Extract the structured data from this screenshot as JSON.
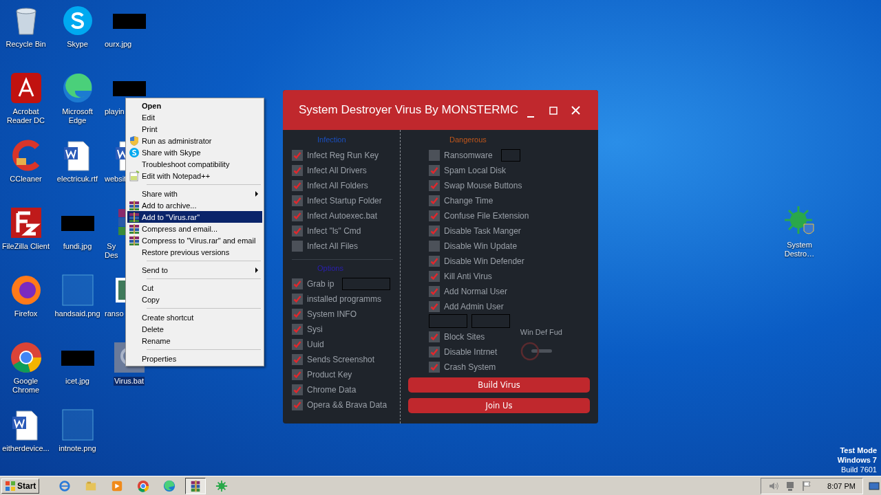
{
  "desktop_icons": [
    {
      "label": "Recycle Bin",
      "kind": "recycle",
      "selected": false
    },
    {
      "label": "Acrobat Reader DC",
      "kind": "acrobat",
      "selected": false
    },
    {
      "label": "CCleaner",
      "kind": "ccleaner",
      "selected": false
    },
    {
      "label": "FileZilla Client",
      "kind": "filezilla",
      "selected": false
    },
    {
      "label": "Firefox",
      "kind": "firefox",
      "selected": false
    },
    {
      "label": "Google Chrome",
      "kind": "chrome",
      "selected": false
    },
    {
      "label": "eitherdevice...",
      "kind": "word",
      "selected": false
    },
    {
      "label": "Skype",
      "kind": "skype",
      "selected": false
    },
    {
      "label": "Microsoft Edge",
      "kind": "edge",
      "selected": false
    },
    {
      "label": "electricuk.rtf",
      "kind": "word",
      "selected": false
    },
    {
      "label": "fundi.jpg",
      "kind": "redacted",
      "selected": false
    },
    {
      "label": "handsaid.png",
      "kind": "blank",
      "selected": false
    },
    {
      "label": "icet.jpg",
      "kind": "redacted",
      "selected": false
    },
    {
      "label": "intnote.png",
      "kind": "blank",
      "selected": false
    },
    {
      "label": "ourx.jpg",
      "kind": "redacted",
      "selected": false
    },
    {
      "label": "playin",
      "kind": "redacted",
      "selected": false
    },
    {
      "label": "websit",
      "kind": "word",
      "selected": false
    },
    {
      "label": "Sy\nDes",
      "kind": "winrar",
      "selected": false
    },
    {
      "label": "ranso",
      "kind": "image",
      "selected": false
    },
    {
      "label": "Virus.bat",
      "kind": "bat",
      "selected": true
    }
  ],
  "right_icon": {
    "label": "System Destro…",
    "kind": "virus"
  },
  "context_menu": [
    {
      "kind": "item",
      "label": "Open",
      "bold": true,
      "selected": false
    },
    {
      "kind": "item",
      "label": "Edit",
      "bold": false,
      "selected": false
    },
    {
      "kind": "item",
      "label": "Print",
      "bold": false,
      "selected": false
    },
    {
      "kind": "shield_item",
      "label": "Run as administrator",
      "bold": false,
      "selected": false
    },
    {
      "kind": "chat_item",
      "label": "Share with Skype",
      "bold": false,
      "selected": false
    },
    {
      "kind": "item",
      "label": "Troubleshoot compatibility",
      "bold": false,
      "selected": false
    },
    {
      "kind": "notepad_item",
      "label": "Edit with Notepad++",
      "bold": false,
      "selected": false
    },
    {
      "kind": "separator"
    },
    {
      "kind": "submenu",
      "label": "Share with",
      "bold": false,
      "selected": false
    },
    {
      "kind": "archive_item",
      "label": "Add to archive...",
      "bold": false,
      "selected": false
    },
    {
      "kind": "archive_item",
      "label": "Add to \"Virus.rar\"",
      "bold": false,
      "selected": true
    },
    {
      "kind": "archive_item",
      "label": "Compress and email...",
      "bold": false,
      "selected": false
    },
    {
      "kind": "archive_item",
      "label": "Compress to \"Virus.rar\" and email",
      "bold": false,
      "selected": false
    },
    {
      "kind": "item",
      "label": "Restore previous versions",
      "bold": false,
      "selected": false
    },
    {
      "kind": "separator"
    },
    {
      "kind": "submenu",
      "label": "Send to",
      "bold": false,
      "selected": false
    },
    {
      "kind": "separator"
    },
    {
      "kind": "item",
      "label": "Cut",
      "bold": false,
      "selected": false
    },
    {
      "kind": "item",
      "label": "Copy",
      "bold": false,
      "selected": false
    },
    {
      "kind": "separator"
    },
    {
      "kind": "item",
      "label": "Create shortcut",
      "bold": false,
      "selected": false
    },
    {
      "kind": "item",
      "label": "Delete",
      "bold": false,
      "selected": false
    },
    {
      "kind": "item",
      "label": "Rename",
      "bold": false,
      "selected": false
    },
    {
      "kind": "separator"
    },
    {
      "kind": "item",
      "label": "Properties",
      "bold": false,
      "selected": false
    }
  ],
  "window": {
    "title": "System Destroyer Virus By MONSTERMC",
    "left_sections": [
      {
        "heading": "Infection",
        "color": "#1a4fc0",
        "items": [
          {
            "kind": "checkbox",
            "label": "Infect Reg Run Key",
            "checked": true
          },
          {
            "kind": "checkbox",
            "label": "Infect All Drivers",
            "checked": true
          },
          {
            "kind": "checkbox",
            "label": "Infect All Folders",
            "checked": true
          },
          {
            "kind": "checkbox",
            "label": "Infect Startup Folder",
            "checked": true
          },
          {
            "kind": "checkbox",
            "label": "Infect Autoexec.bat",
            "checked": true
          },
          {
            "kind": "checkbox",
            "label": "Infect \"ls\" Cmd",
            "checked": true
          },
          {
            "kind": "checkbox",
            "label": "Infect All  Files",
            "checked": false
          }
        ]
      },
      {
        "heading": "Options",
        "color": "#2a1fb0",
        "items": [
          {
            "kind": "checkbox_field",
            "label": "Grab ip",
            "checked": true
          },
          {
            "kind": "checkbox",
            "label": "installed programms",
            "checked": true
          },
          {
            "kind": "checkbox",
            "label": "System INFO",
            "checked": true
          },
          {
            "kind": "checkbox",
            "label": "Sysi",
            "checked": true
          },
          {
            "kind": "checkbox",
            "label": "Uuid",
            "checked": true
          },
          {
            "kind": "checkbox",
            "label": "Sends Screenshot",
            "checked": true
          },
          {
            "kind": "checkbox",
            "label": "Product Key",
            "checked": true
          },
          {
            "kind": "checkbox",
            "label": "Chrome Data",
            "checked": true
          },
          {
            "kind": "checkbox",
            "label": "Opera && Brava Data",
            "checked": true
          }
        ]
      }
    ],
    "right_section": {
      "heading": "Dangerous",
      "color": "#c0561b",
      "items": [
        {
          "kind": "checkbox_field",
          "label": "Ransomware",
          "checked": false
        },
        {
          "kind": "checkbox",
          "label": "Spam Local Disk",
          "checked": true
        },
        {
          "kind": "checkbox",
          "label": "Swap Mouse Buttons",
          "checked": true
        },
        {
          "kind": "checkbox",
          "label": "Change Time",
          "checked": true
        },
        {
          "kind": "checkbox",
          "label": "Confuse File Extension",
          "checked": true
        },
        {
          "kind": "checkbox",
          "label": "Disable Task Manger",
          "checked": true
        },
        {
          "kind": "checkbox",
          "label": "Disable Win Update",
          "checked": false
        },
        {
          "kind": "checkbox",
          "label": "Disable Win Defender",
          "checked": true
        },
        {
          "kind": "checkbox",
          "label": "Kill Anti Virus",
          "checked": true
        },
        {
          "kind": "checkbox",
          "label": "Add Normal User",
          "checked": true
        },
        {
          "kind": "checkbox",
          "label": "Add Admin User",
          "checked": true
        },
        {
          "kind": "field_pair"
        },
        {
          "kind": "checkbox",
          "label": "Block Sites",
          "checked": true
        },
        {
          "kind": "checkbox",
          "label": "Disable Intrnet",
          "checked": true
        },
        {
          "kind": "checkbox",
          "label": "Crash System",
          "checked": true
        }
      ]
    },
    "toggle": {
      "label": "Win Def Fud",
      "on": false
    },
    "buttons": [
      "Build Virus",
      "Join Us"
    ]
  },
  "watermark_text": [
    "Test Mode",
    "Windows 7",
    "Build 7601"
  ],
  "taskbar": {
    "start": "Start",
    "apps": [
      {
        "kind": "ie",
        "selected": false
      },
      {
        "kind": "explorer",
        "selected": false
      },
      {
        "kind": "media",
        "selected": false
      },
      {
        "kind": "chrome",
        "selected": false
      },
      {
        "kind": "edge",
        "selected": false
      },
      {
        "kind": "winrar",
        "selected": true
      },
      {
        "kind": "virus",
        "selected": false
      }
    ],
    "clock": "8:07 PM"
  }
}
